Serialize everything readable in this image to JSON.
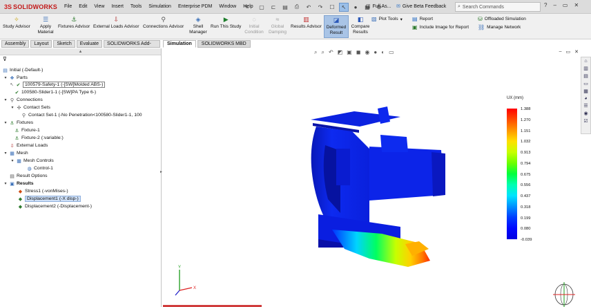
{
  "app": {
    "logo_prefix": "3S",
    "logo_text": "SOLIDWORKS"
  },
  "menu": [
    "File",
    "Edit",
    "View",
    "Insert",
    "Tools",
    "Simulation",
    "Enterprise PDM",
    "Window",
    "Help"
  ],
  "toolbar_right": {
    "full_as": "Full As...",
    "beta": "Give Beta Feedback",
    "search_placeholder": "Search Commands"
  },
  "commands": {
    "study_advisor": "Study Advisor",
    "apply_material": "Apply Material",
    "fixtures_advisor": "Fixtures Advisor",
    "external_loads_advisor": "External Loads Advisor",
    "connections_advisor": "Connections Advisor",
    "shell_manager": "Shell Manager",
    "run_this_study": "Run This Study",
    "initial_condition": "Initial Condition",
    "global_damping": "Global Damping",
    "results_advisor": "Results Advisor",
    "deformed_result": "Deformed Result",
    "compare_results": "Compare Results",
    "plot_tools": "Plot Tools",
    "report": "Report",
    "include_image": "Include Image for Report",
    "offloaded_simulation": "Offloaded Simulation",
    "manage_network": "Manage Network"
  },
  "tabs": [
    "Assembly",
    "Layout",
    "Sketch",
    "Evaluate",
    "SOLIDWORKS Add-Ins"
  ],
  "view_tabs": [
    "Simulation",
    "SOLIDWORKS MBD"
  ],
  "tree": {
    "root": "Initial (-Default-)",
    "parts": "Parts",
    "part1": "100579-Safety-1 (-[SW]Molded ABS-)",
    "part2": "100580-Slider1-1 (-[SW]PA Type 6-)",
    "connections": "Connections",
    "contact_sets": "Contact Sets",
    "contact_set1": "Contact Set-1 (-No Penetration<100580-Slider1-1, 100",
    "fixtures": "Fixtures",
    "fixture1": "Fixture-1",
    "fixture2": "Fixture-2 (:variable:)",
    "external_loads": "External Loads",
    "mesh": "Mesh",
    "mesh_controls": "Mesh Controls",
    "control1": "Control-1",
    "result_options": "Result Options",
    "results": "Results",
    "stress1": "Stress1 (-vonMises-)",
    "displacement1": "Displacement1 (-X disp-)",
    "displacement2": "Displacement2 (-Displacement-)"
  },
  "legend": {
    "title": "UX (mm)",
    "values": [
      "1.388",
      "1.270",
      "1.151",
      "1.032",
      "0.913",
      "0.794",
      "0.675",
      "0.556",
      "0.437",
      "0.318",
      "0.199",
      "0.080",
      "-0.039"
    ],
    "colors": [
      "#ff0000",
      "#ff4a00",
      "#ff9600",
      "#ffe000",
      "#c8ff00",
      "#6cff00",
      "#00ff3c",
      "#00ffb0",
      "#00e4ff",
      "#0090ff",
      "#003cff",
      "#0008ff",
      "#0000e0"
    ]
  },
  "colors": {
    "model_blue": "#0a1ee6",
    "model_dark_blue": "#0a10b0",
    "highlight": "#a9c4e6"
  }
}
